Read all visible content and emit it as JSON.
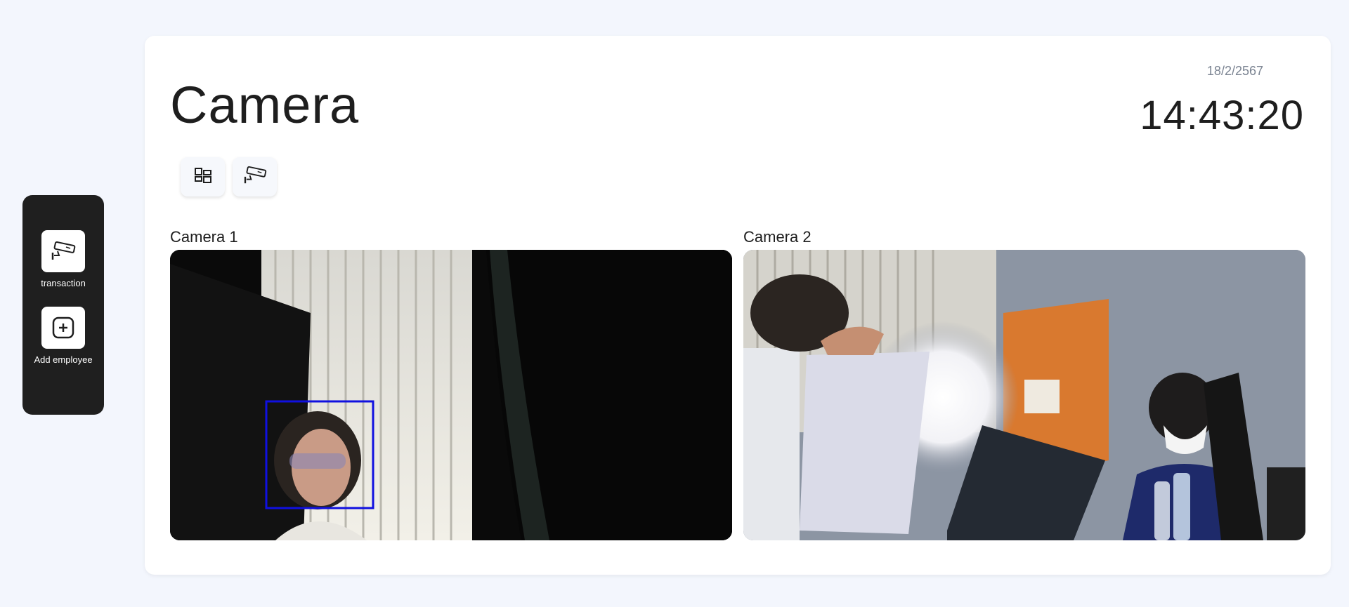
{
  "sidebar": {
    "items": [
      {
        "label": "transaction",
        "icon": "cctv-camera-icon"
      },
      {
        "label": "Add employee",
        "icon": "add-square-icon"
      }
    ]
  },
  "header": {
    "title": "Camera",
    "date": "18/2/2567",
    "time": "14:43:20"
  },
  "toolbar": {
    "buttons": [
      {
        "icon": "dashboard-layout-icon"
      },
      {
        "icon": "cctv-camera-icon"
      }
    ]
  },
  "cameras": [
    {
      "label": "Camera 1"
    },
    {
      "label": "Camera 2"
    }
  ],
  "colors": {
    "page_bg": "#f3f6fd",
    "sidebar_bg": "#1f1f1f",
    "card_bg": "#ffffff",
    "face_box": "#1010e0"
  }
}
